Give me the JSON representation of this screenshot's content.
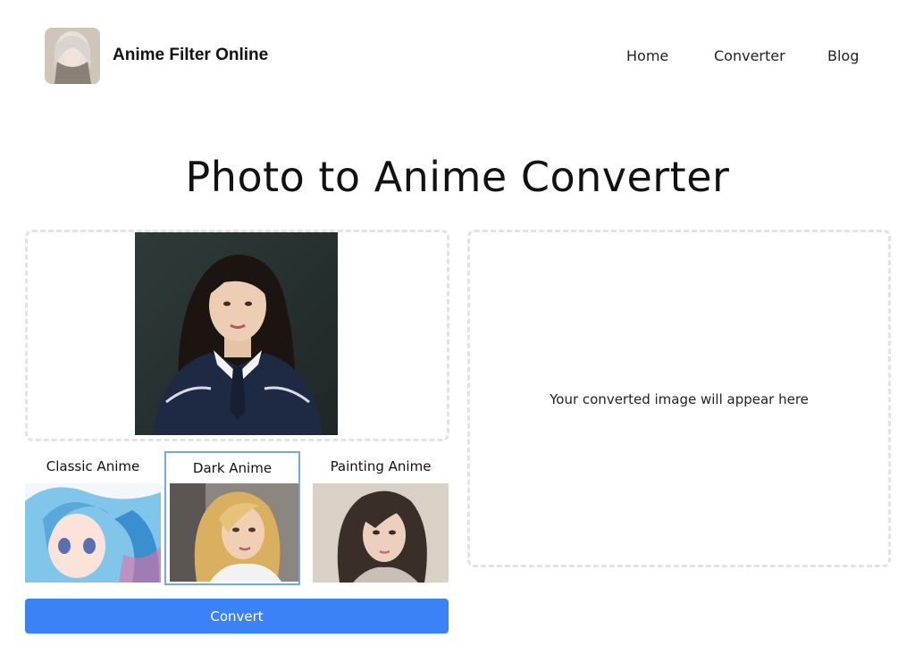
{
  "header": {
    "brand": "Anime Filter Online",
    "nav": {
      "home": "Home",
      "converter": "Converter",
      "blog": "Blog"
    }
  },
  "main": {
    "title": "Photo to Anime Converter",
    "uploaded_image": "portrait-photo",
    "styles": [
      {
        "label": "Classic Anime",
        "selected": false
      },
      {
        "label": "Dark Anime",
        "selected": true
      },
      {
        "label": "Painting Anime",
        "selected": false
      }
    ],
    "convert_label": "Convert",
    "result_placeholder": "Your converted image will appear here"
  },
  "colors": {
    "accent": "#3b82f6",
    "selected_border": "#7aa7db",
    "dashed_border": "#e3e3e3"
  }
}
